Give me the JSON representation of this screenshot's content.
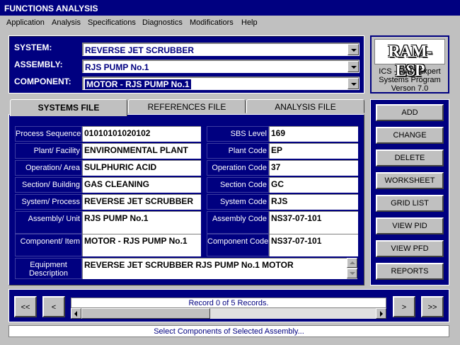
{
  "window": {
    "title": "FUNCTIONS ANALYSIS"
  },
  "menu": [
    "Application",
    "Analysis",
    "Specifications",
    "Diagnostics",
    "Modificatiors",
    "Help"
  ],
  "header": {
    "system_label": "SYSTEM:",
    "system_value": "REVERSE JET SCRUBBER",
    "assembly_label": "ASSEMBLY:",
    "assembly_value": "RJS PUMP No.1",
    "component_label": "COMPONENT:",
    "component_value": "MOTOR -  RJS PUMP No.1"
  },
  "logo": {
    "mark": "RAM-ESP",
    "line1": "ICS - RAM Expert",
    "line2": "Systems Program",
    "line3": "Verson 7.0"
  },
  "tabs": [
    "SYSTEMS FILE",
    "REFERENCES FILE",
    "ANALYSIS FILE"
  ],
  "fields": {
    "process_sequence": {
      "label": "Process Sequence",
      "value": "01010101020102"
    },
    "plant_facility": {
      "label": "Plant/ Facility",
      "value": "ENVIRONMENTAL PLANT"
    },
    "operation_area": {
      "label": "Operation/ Area",
      "value": "SULPHURIC ACID"
    },
    "section_building": {
      "label": "Section/ Building",
      "value": "GAS CLEANING"
    },
    "system_process": {
      "label": "System/ Process",
      "value": "REVERSE JET SCRUBBER"
    },
    "assembly_unit": {
      "label": "Assembly/ Unit",
      "value": "RJS PUMP No.1"
    },
    "component_item": {
      "label": "Component/ Item",
      "value": "MOTOR -  RJS PUMP No.1"
    },
    "equipment_description": {
      "label_line1": "Equipment",
      "label_line2": "Description",
      "value": "REVERSE JET SCRUBBER RJS PUMP No.1 MOTOR"
    },
    "sbs_level": {
      "label": "SBS Level",
      "value": "169"
    },
    "plant_code": {
      "label": "Plant Code",
      "value": "EP"
    },
    "operation_code": {
      "label": "Operation Code",
      "value": "37"
    },
    "section_code": {
      "label": "Section Code",
      "value": "GC"
    },
    "system_code": {
      "label": "System Code",
      "value": "RJS"
    },
    "assembly_code": {
      "label": "Assembly Code",
      "value": "NS37-07-101"
    },
    "component_code": {
      "label": "Component Code",
      "value": "NS37-07-101"
    }
  },
  "actions": [
    "ADD",
    "CHANGE",
    "DELETE",
    "WORKSHEET",
    "GRID LIST",
    "VIEW PID",
    "VIEW PFD",
    "REPORTS"
  ],
  "navigation": {
    "first": "<<",
    "prev": "<",
    "next": ">",
    "last": ">>",
    "record_text": "Record 0 of 5 Records."
  },
  "status": "Select Components of Selected Assembly..."
}
